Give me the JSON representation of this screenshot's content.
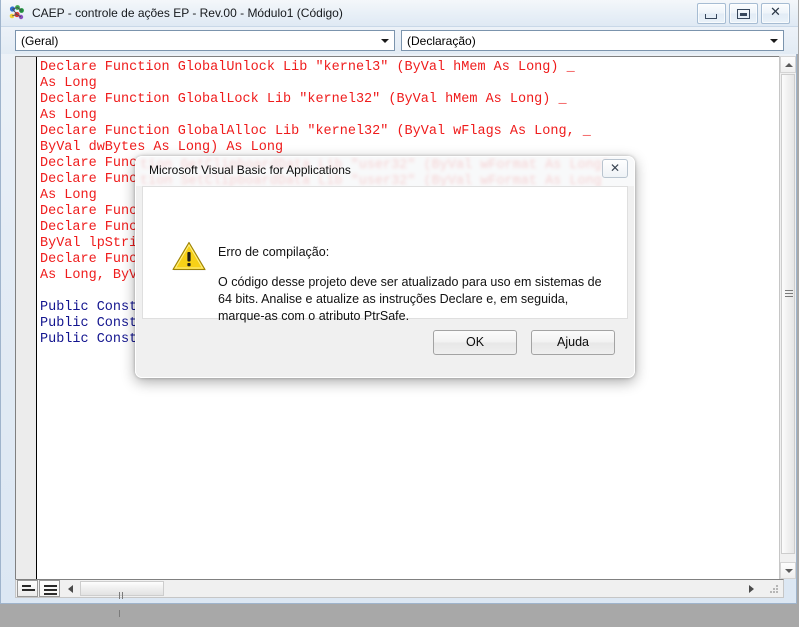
{
  "window": {
    "title": "CAEP - controle de ações EP - Rev.00 - Módulo1 (Código)",
    "icon": "vba-module-icon",
    "controls": {
      "minimize": "minimize-icon",
      "restore": "restore-icon",
      "close": "close-icon"
    }
  },
  "toolbar": {
    "object_combo": {
      "value": "(Geral)",
      "arrow": "chevron-down-icon"
    },
    "procedure_combo": {
      "value": "(Declaração)",
      "arrow": "chevron-down-icon"
    }
  },
  "code": {
    "language": "vba",
    "lines": [
      {
        "text": "Declare Function GlobalUnlock Lib \"kernel3\" (ByVal hMem As Long) _",
        "color": "red"
      },
      {
        "text": "As Long",
        "color": "red"
      },
      {
        "text": "Declare Function GlobalLock Lib \"kernel32\" (ByVal hMem As Long) _",
        "color": "red"
      },
      {
        "text": "As Long",
        "color": "red"
      },
      {
        "text": "Declare Function GlobalAlloc Lib \"kernel32\" (ByVal wFlags As Long, _",
        "color": "red"
      },
      {
        "text": "ByVal dwBytes As Long) As Long",
        "color": "red"
      },
      {
        "text": "Declare Func",
        "color": "red"
      },
      {
        "text": "Declare Func",
        "color": "red"
      },
      {
        "text": "As Long",
        "color": "red"
      },
      {
        "text": "Declare Func",
        "color": "red"
      },
      {
        "text": "Declare Func",
        "color": "red"
      },
      {
        "text": "ByVal lpStri",
        "color": "red"
      },
      {
        "text": "Declare Func",
        "color": "red"
      },
      {
        "text": "As Long, ByV",
        "color": "red"
      },
      {
        "text": "",
        "color": "red"
      },
      {
        "text": "Public Const",
        "color": "blue"
      },
      {
        "text": "Public Const",
        "color": "blue"
      },
      {
        "text": "Public Const",
        "color": "blue"
      }
    ],
    "colors": {
      "red": "#ef1c1c",
      "blue": "#13158f"
    }
  },
  "scrollbars": {
    "vertical": {
      "up_arrow": "scroll-up-icon",
      "down_arrow": "scroll-down-icon",
      "thumb": "vertical-scroll-thumb"
    },
    "horizontal": {
      "left_arrow": "scroll-left-icon",
      "right_arrow": "scroll-right-icon",
      "thumb": "horizontal-scroll-thumb"
    }
  },
  "view_buttons": {
    "procedure_view": "procedure-view-icon",
    "full_module_view": "full-module-view-icon"
  },
  "dialog": {
    "title": "Microsoft Visual Basic for Applications",
    "close_label": "✕",
    "icon": "warning-icon",
    "heading": "Erro de compilação:",
    "message": "O código desse projeto deve ser atualizado para uso em sistemas de 64 bits.  Analise e atualize as instruções Declare e, em seguida, marque-as com o atributo PtrSafe.",
    "buttons": {
      "ok": "OK",
      "help": "Ajuda"
    }
  }
}
